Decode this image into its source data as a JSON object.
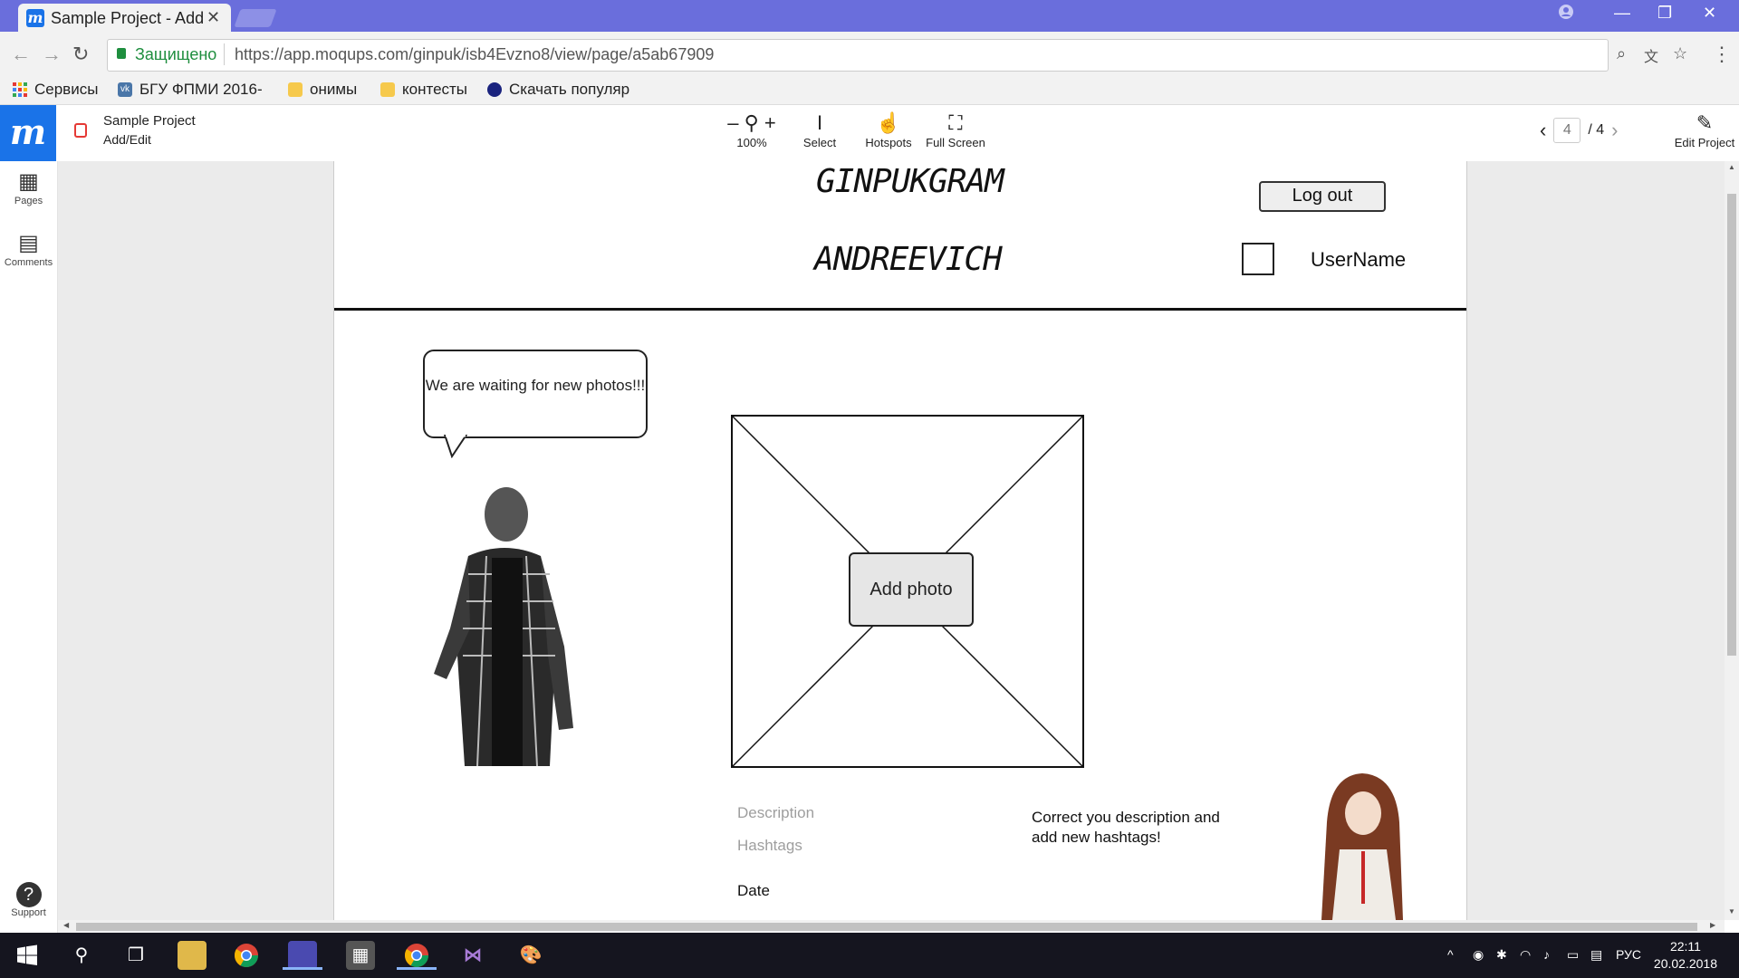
{
  "browser": {
    "tab_title": "Sample Project - Add",
    "address_secure_label": "Защищено",
    "url": "https://app.moqups.com/ginpuk/isb4Evzno8/view/page/a5ab67909",
    "bookmarks": [
      {
        "label": "Сервисы",
        "icon": "apps-grid-icon",
        "color": "#e53935"
      },
      {
        "label": "БГУ ФПМИ 2016-",
        "icon": "vk-icon",
        "color": "#4a76a8"
      },
      {
        "label": "онимы",
        "icon": "folder-icon",
        "color": "#f6c94c"
      },
      {
        "label": "контесты",
        "icon": "folder-icon",
        "color": "#f6c94c"
      },
      {
        "label": "Скачать популяр",
        "icon": "globe-icon",
        "color": "#1a237e"
      }
    ]
  },
  "moqups": {
    "project_title": "Sample Project",
    "project_subtitle": "Add/Edit",
    "tools": {
      "zoom": "100%",
      "select": "Select",
      "hotspots": "Hotspots",
      "fullscreen": "Full Screen"
    },
    "pager": {
      "current": "4",
      "total": "/ 4"
    },
    "edit_project": "Edit Project",
    "sidebar": {
      "pages": "Pages",
      "comments": "Comments",
      "support": "Support"
    }
  },
  "mockup": {
    "brand_top": "GINPUKGRAM",
    "brand_bottom": "ANDREEVICH",
    "logout_label": "Log out",
    "username": "UserName",
    "bubble_text": "We are waiting for new photos!!!",
    "add_photo_label": "Add photo",
    "description_placeholder": "Description",
    "hashtags_placeholder": "Hashtags",
    "date_label": "Date",
    "hint_text": "Correct you description and add new hashtags!"
  },
  "taskbar": {
    "language": "РУС",
    "time": "22:11",
    "date": "20.02.2018"
  },
  "colors": {
    "titlebar": "#6a6edc",
    "moqups_blue": "#1a73e8",
    "secure_green": "#1e8e3e"
  }
}
